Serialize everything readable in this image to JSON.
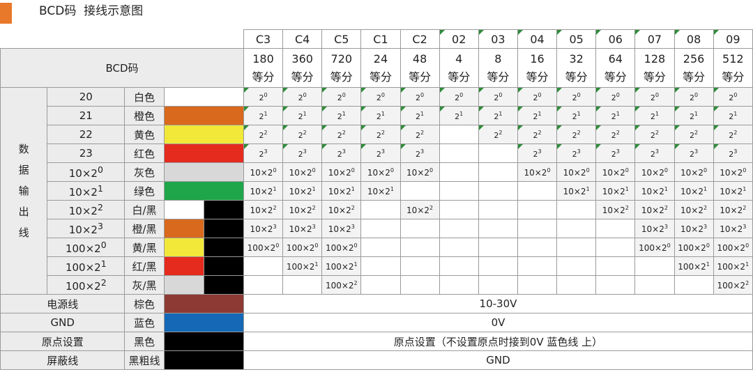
{
  "header": {
    "title": "BCD码  接线示意图"
  },
  "table": {
    "row_header_label": "BCD码",
    "side_label": [
      "数",
      "据",
      "输",
      "出",
      "线"
    ],
    "unit": "等分",
    "columns": [
      {
        "code": "C3",
        "div": "180",
        "flag": false
      },
      {
        "code": "C4",
        "div": "360",
        "flag": false
      },
      {
        "code": "C5",
        "div": "720",
        "flag": false
      },
      {
        "code": "C1",
        "div": "24",
        "flag": false
      },
      {
        "code": "C2",
        "div": "48",
        "flag": false
      },
      {
        "code": "02",
        "div": "4",
        "flag": true
      },
      {
        "code": "03",
        "div": "8",
        "flag": true
      },
      {
        "code": "04",
        "div": "16",
        "flag": true
      },
      {
        "code": "05",
        "div": "32",
        "flag": true
      },
      {
        "code": "06",
        "div": "64",
        "flag": true
      },
      {
        "code": "07",
        "div": "128",
        "flag": true
      },
      {
        "code": "08",
        "div": "256",
        "flag": true
      },
      {
        "code": "09",
        "div": "512",
        "flag": true
      }
    ],
    "groups": [
      {
        "rows": [
          {
            "label": "20",
            "color_name": "白色",
            "swatch": [
              "#ffffff"
            ],
            "cell": {
              "base": "",
              "exp": "0",
              "type": "pow"
            },
            "active": [
              1,
              1,
              1,
              1,
              1,
              1,
              1,
              1,
              1,
              1,
              1,
              1,
              1
            ]
          },
          {
            "label": "21",
            "color_name": "橙色",
            "swatch": [
              "#d9691c"
            ],
            "cell": {
              "base": "",
              "exp": "1",
              "type": "pow"
            },
            "active": [
              1,
              1,
              1,
              1,
              1,
              1,
              1,
              1,
              1,
              1,
              1,
              1,
              1
            ]
          },
          {
            "label": "22",
            "color_name": "黄色",
            "swatch": [
              "#f1e83a"
            ],
            "cell": {
              "base": "",
              "exp": "2",
              "type": "pow"
            },
            "active": [
              1,
              1,
              1,
              1,
              1,
              0,
              1,
              1,
              1,
              1,
              1,
              1,
              1
            ]
          },
          {
            "label": "23",
            "color_name": "红色",
            "swatch": [
              "#e52a1e"
            ],
            "cell": {
              "base": "",
              "exp": "3",
              "type": "pow"
            },
            "active": [
              1,
              1,
              1,
              1,
              1,
              0,
              0,
              1,
              1,
              1,
              1,
              1,
              1
            ]
          }
        ]
      },
      {
        "rows": [
          {
            "label": "10×2",
            "label_exp": "0",
            "color_name": "灰色",
            "swatch": [
              "#d8d8d8"
            ],
            "cell": {
              "base": "10×2",
              "exp": "0"
            },
            "active": [
              1,
              1,
              1,
              1,
              1,
              0,
              0,
              1,
              1,
              1,
              1,
              1,
              1
            ]
          },
          {
            "label": "10×2",
            "label_exp": "1",
            "color_name": "绿色",
            "swatch": [
              "#1fa64a"
            ],
            "cell": {
              "base": "10×2",
              "exp": "1"
            },
            "active": [
              1,
              1,
              1,
              1,
              0,
              0,
              0,
              0,
              1,
              1,
              1,
              1,
              1
            ]
          },
          {
            "label": "10×2",
            "label_exp": "2",
            "color_name": "白/黑",
            "swatch": [
              "#ffffff",
              "#000000"
            ],
            "cell": {
              "base": "10×2",
              "exp": "2"
            },
            "active": [
              1,
              1,
              1,
              0,
              1,
              0,
              0,
              0,
              0,
              1,
              1,
              1,
              1
            ]
          },
          {
            "label": "10×2",
            "label_exp": "3",
            "color_name": "橙/黑",
            "swatch": [
              "#d9691c",
              "#000000"
            ],
            "cell": {
              "base": "10×2",
              "exp": "3"
            },
            "active": [
              1,
              1,
              1,
              0,
              0,
              0,
              0,
              0,
              0,
              0,
              1,
              1,
              1
            ]
          }
        ]
      },
      {
        "rows": [
          {
            "label": "100×2",
            "label_exp": "0",
            "color_name": "黄/黑",
            "swatch": [
              "#f1e83a",
              "#000000"
            ],
            "cell": {
              "base": "100×2",
              "exp": "0"
            },
            "active": [
              1,
              1,
              1,
              0,
              0,
              0,
              0,
              0,
              0,
              0,
              1,
              1,
              1
            ]
          },
          {
            "label": "100×2",
            "label_exp": "1",
            "color_name": "红/黑",
            "swatch": [
              "#e52a1e",
              "#000000"
            ],
            "cell": {
              "base": "100×2",
              "exp": "1"
            },
            "active": [
              0,
              1,
              1,
              0,
              0,
              0,
              0,
              0,
              0,
              0,
              0,
              1,
              1
            ]
          },
          {
            "label": "100×2",
            "label_exp": "2",
            "color_name": "灰/黑",
            "swatch": [
              "#d8d8d8",
              "#000000"
            ],
            "cell": {
              "base": "100×2",
              "exp": "2"
            },
            "active": [
              0,
              0,
              1,
              0,
              0,
              0,
              0,
              0,
              0,
              0,
              0,
              0,
              1
            ]
          }
        ]
      }
    ],
    "footer": [
      {
        "name": "电源线",
        "color_name": "棕色",
        "swatch": "#8c3a33",
        "value": "10-30V"
      },
      {
        "name": "GND",
        "color_name": "蓝色",
        "swatch": "#1468b5",
        "value": "0V"
      },
      {
        "name": "原点设置",
        "color_name": "黑色",
        "swatch": "#000000",
        "value": "原点设置（不设置原点时接到0V 蓝色线 上）"
      },
      {
        "name": "屏蔽线",
        "color_name": "黑粗线",
        "swatch": "#000000",
        "value": "GND"
      }
    ]
  }
}
